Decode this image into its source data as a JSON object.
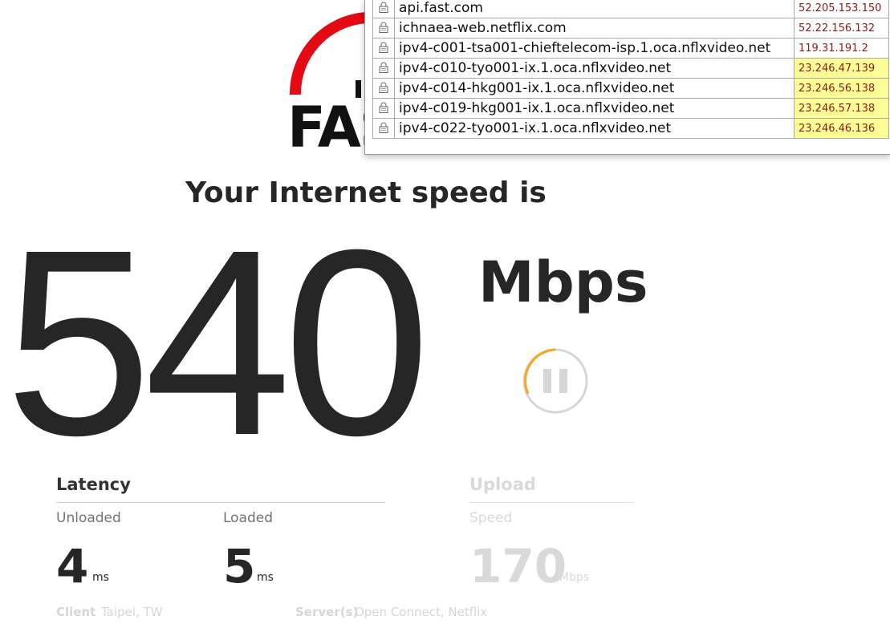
{
  "logo": {
    "text": "FAST"
  },
  "ip_popup": {
    "rows": [
      {
        "host": "api.fast.com",
        "ip": "52.205.153.150",
        "highlight": false
      },
      {
        "host": "ichnaea-web.netflix.com",
        "ip": "52.22.156.132",
        "highlight": false
      },
      {
        "host": "ipv4-c001-tsa001-chieftelecom-isp.1.oca.nflxvideo.net",
        "ip": "119.31.191.2",
        "highlight": false
      },
      {
        "host": "ipv4-c010-tyo001-ix.1.oca.nflxvideo.net",
        "ip": "23.246.47.139",
        "highlight": true
      },
      {
        "host": "ipv4-c014-hkg001-ix.1.oca.nflxvideo.net",
        "ip": "23.246.56.138",
        "highlight": true
      },
      {
        "host": "ipv4-c019-hkg001-ix.1.oca.nflxvideo.net",
        "ip": "23.246.57.138",
        "highlight": true
      },
      {
        "host": "ipv4-c022-tyo001-ix.1.oca.nflxvideo.net",
        "ip": "23.246.46.136",
        "highlight": true
      }
    ]
  },
  "speed": {
    "headline": "Your Internet speed is",
    "value": "540",
    "units": "Mbps"
  },
  "latency": {
    "title": "Latency",
    "unloaded_label": "Unloaded",
    "unloaded_value": "4",
    "unloaded_unit": "ms",
    "loaded_label": "Loaded",
    "loaded_value": "5",
    "loaded_unit": "ms"
  },
  "upload": {
    "title": "Upload",
    "speed_label": "Speed",
    "speed_value": "170",
    "speed_unit": "Mbps"
  },
  "footer": {
    "client_label": "Client",
    "client_value": "Taipei, TW",
    "server_label": "Server(s)",
    "server_value": "Open Connect, Netflix"
  },
  "colors": {
    "brand_red": "#e50914",
    "progress_orange": "#f5a623",
    "highlight_yellow": "#fdfd96",
    "ip_text": "#8b1a1a"
  }
}
